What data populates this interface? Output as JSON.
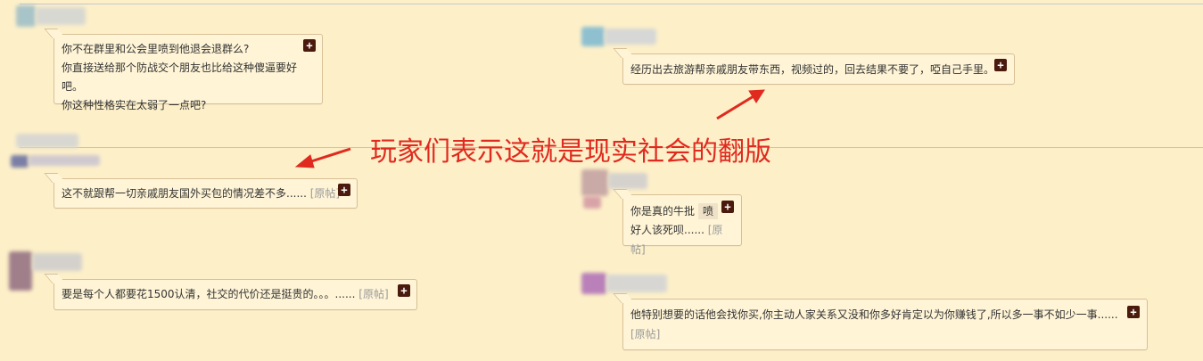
{
  "comments": [
    {
      "lines": [
        "你不在群里和公会里喷到他退会退群么?",
        "你直接送给那个防战交个朋友也比给这种傻逼要好吧。",
        "你这种性格实在太弱了一点吧?"
      ]
    },
    {
      "text": "经历出去旅游帮亲戚朋友带东西，视频过的，回去结果不要了，啞自己手里。"
    },
    {
      "text": "这不就跟帮一切亲戚朋友国外买包的情况差不多......",
      "orig_label": "[原帖]"
    },
    {
      "line1": "你是真的牛批",
      "tag": "喷",
      "line2": "好人该死呗......",
      "orig_label": "[原帖]"
    },
    {
      "text": "要是每个人都要花1500认清，社交的代价还是挺贵的。。。......",
      "orig_label": "[原帖]"
    },
    {
      "text": "他特别想要的话他会找你买,你主动人家关系又没和你多好肯定以为你赚钱了,所以多一事不如少一事......",
      "orig_label": "[原帖]"
    }
  ],
  "plus_symbol": "+",
  "annotation": "玩家们表示这就是现实社会的翻版",
  "colors": {
    "background": "#fdf0c9",
    "bubble": "#fff4d6",
    "border": "#d7bf96",
    "annotation": "#e02a1f",
    "plus_button": "#4a1a0d"
  }
}
